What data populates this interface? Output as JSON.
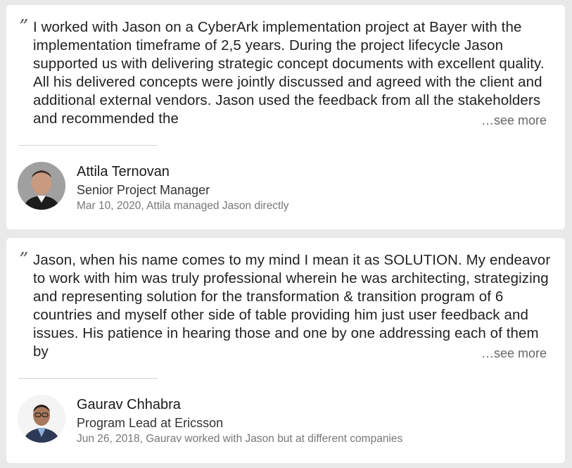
{
  "recommendations": [
    {
      "text": "I worked with Jason on a CyberArk implementation project at Bayer with the implementation timeframe of 2,5 years. During the project lifecycle Jason supported us with delivering strategic concept documents with excellent quality. All his delivered concepts were jointly discussed and agreed with the client and additional external vendors. Jason used the feedback from all the stakeholders and recommended the",
      "see_more_label": "…see more",
      "name": "Attila Ternovan",
      "title": "Senior Project Manager",
      "meta": "Mar 10, 2020, Attila managed Jason directly"
    },
    {
      "text": "Jason, when his name comes to my mind I mean it as SOLUTION. My endeavor to work with him was truly professional wherein he was architecting, strategizing and representing solution for the transformation & transition program of 6 countries and myself other side of table providing him just user feedback and issues. His patience in hearing those and one by one addressing each of them by",
      "see_more_label": "…see more",
      "name": "Gaurav Chhabra",
      "title": "Program Lead at Ericsson",
      "meta": "Jun 26, 2018, Gaurav worked with Jason but at different companies"
    }
  ],
  "quote_glyph": "”",
  "colors": {
    "page_background": "#e9e9e9",
    "card_background": "#ffffff",
    "text": "#222222",
    "muted": "#777777"
  }
}
